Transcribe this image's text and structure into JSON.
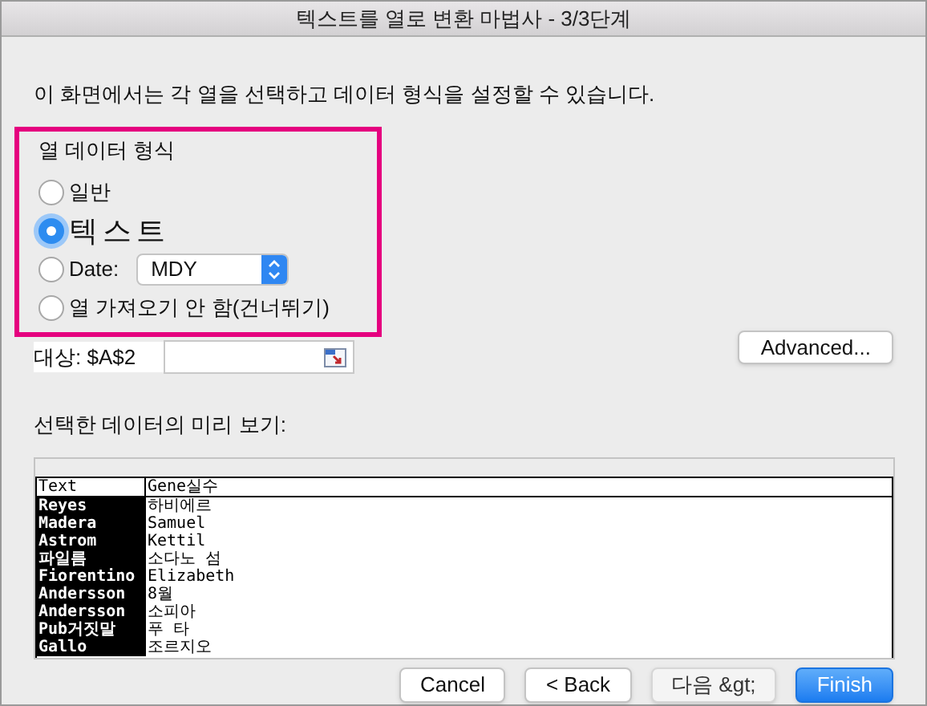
{
  "window": {
    "title": "텍스트를 열로 변환 마법사 - 3/3단계"
  },
  "intro": "이 화면에서는 각 열을 선택하고 데이터 형식을 설정할 수 있습니다.",
  "column_data_format": {
    "title": "열 데이터 형식",
    "highlighted": true,
    "options": [
      {
        "kind": "radio",
        "label": "일반",
        "selected": false
      },
      {
        "kind": "radio",
        "label": "텍스트",
        "selected": true
      },
      {
        "kind": "date",
        "label": "Date:",
        "selected": false,
        "dropdown": "MDY"
      },
      {
        "kind": "radio",
        "label": "열 가져오기 안 함(건너뛰기)",
        "selected": false
      }
    ]
  },
  "destination": {
    "label": "대상: $A$2"
  },
  "advanced_button": "Advanced...",
  "preview": {
    "title": "선택한 데이터의 미리 보기:",
    "columns": [
      {
        "header": "Text",
        "selected": true
      },
      {
        "header": "Gene실수",
        "selected": false
      }
    ],
    "rows": [
      [
        "Reyes",
        "하비에르"
      ],
      [
        "Madera",
        "Samuel"
      ],
      [
        "Astrom",
        "Kettil"
      ],
      [
        "파일름",
        "소다노 섬"
      ],
      [
        "Fiorentino",
        "Elizabeth"
      ],
      [
        "Andersson",
        "8월"
      ],
      [
        "Andersson",
        "소피아"
      ],
      [
        "Pub거짓말",
        "푸 타"
      ],
      [
        "Gallo",
        "조르지오"
      ]
    ]
  },
  "buttons": [
    {
      "label": "Cancel",
      "kind": "normal"
    },
    {
      "label": "< Back",
      "kind": "normal"
    },
    {
      "label": "다음 &gt;",
      "kind": "disabled"
    },
    {
      "label": "Finish",
      "kind": "default"
    }
  ]
}
